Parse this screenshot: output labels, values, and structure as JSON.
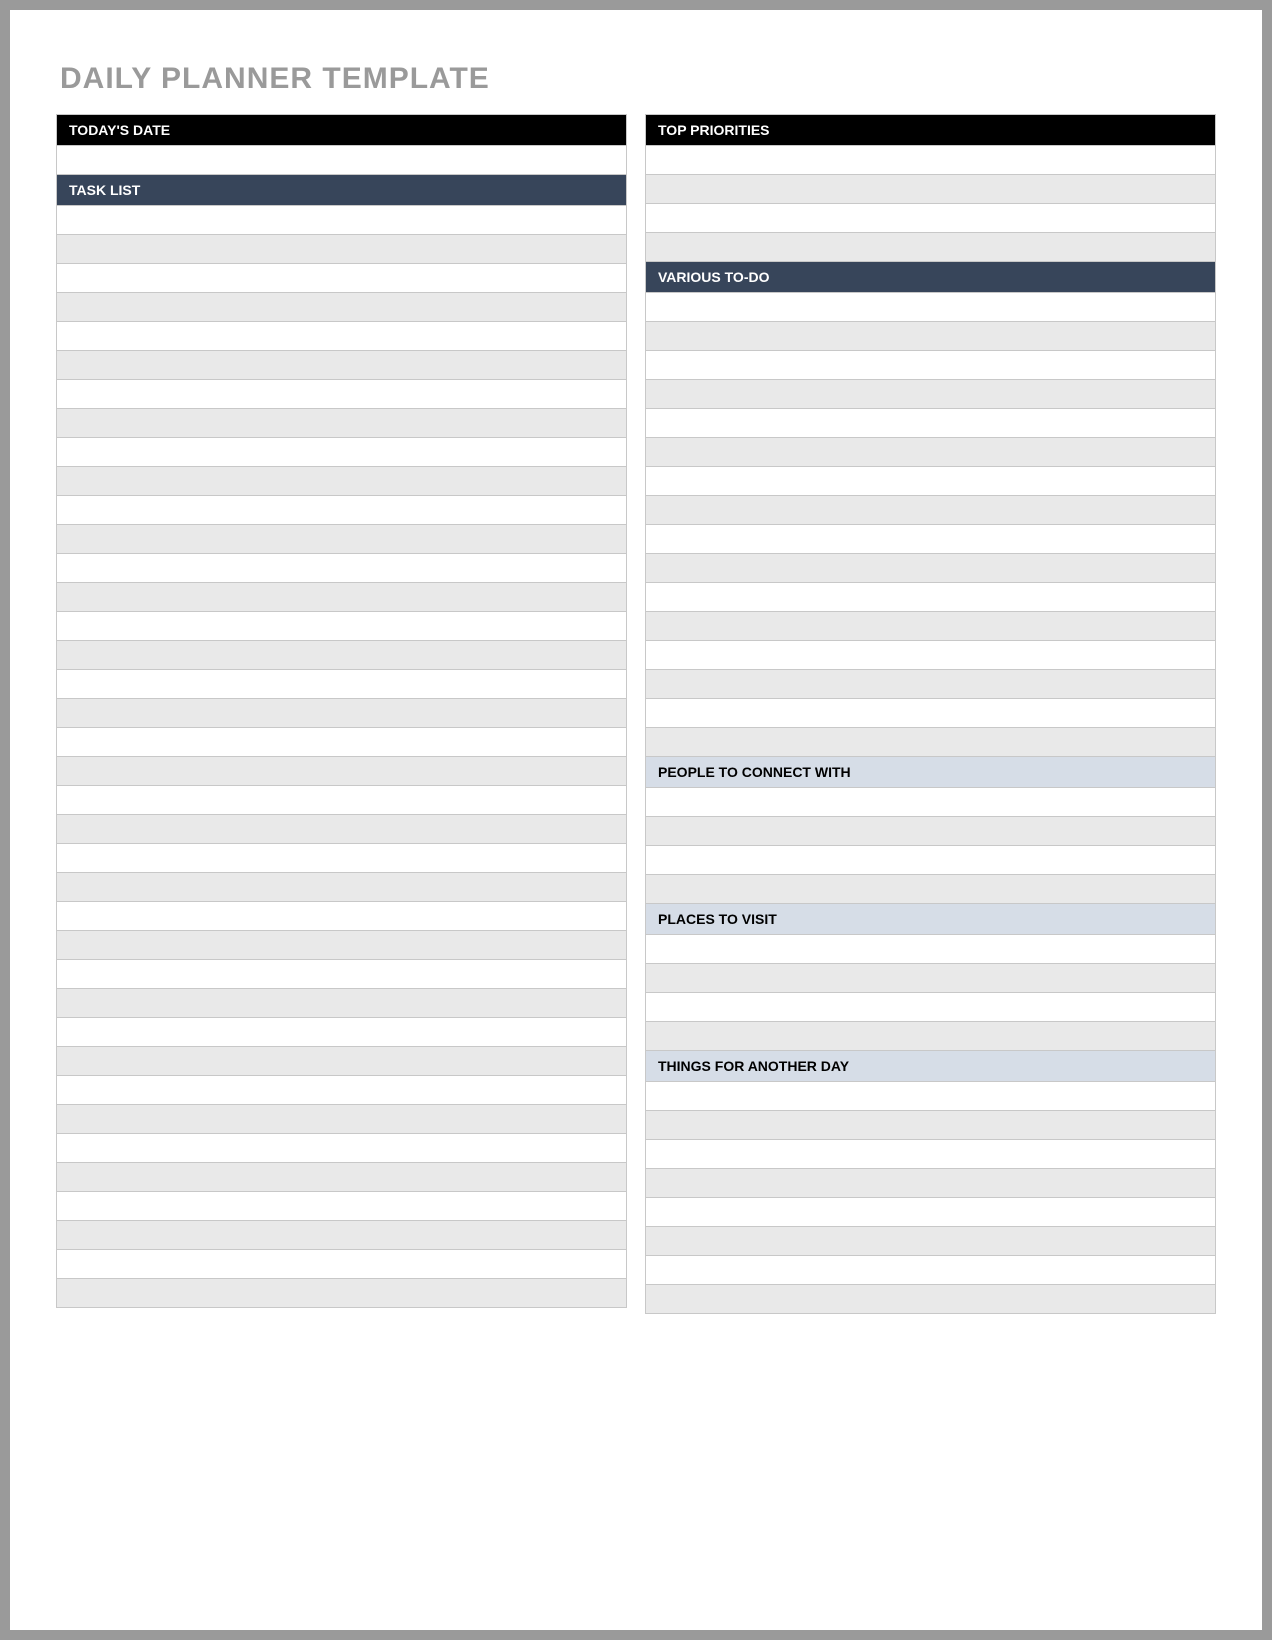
{
  "title": "DAILY PLANNER TEMPLATE",
  "left": {
    "todays_date": "TODAY'S DATE",
    "task_list": "TASK LIST"
  },
  "right": {
    "top_priorities": "TOP PRIORITIES",
    "various_todo": "VARIOUS TO-DO",
    "people_connect": "PEOPLE TO CONNECT WITH",
    "places_visit": "PLACES TO VISIT",
    "things_another_day": "THINGS FOR ANOTHER DAY"
  }
}
